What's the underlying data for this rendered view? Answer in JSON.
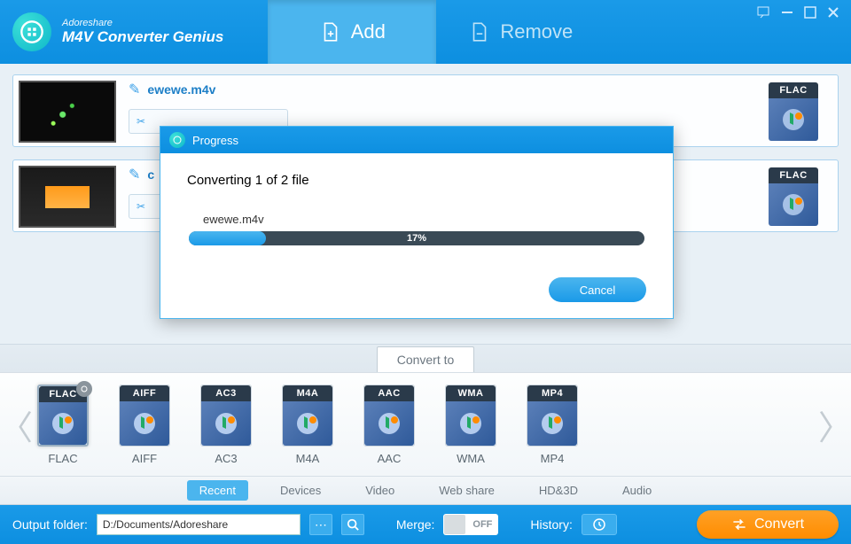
{
  "brand": {
    "company": "Adoreshare",
    "product": "M4V Converter Genius"
  },
  "header": {
    "add_label": "Add",
    "remove_label": "Remove"
  },
  "files": [
    {
      "name": "ewewe.m4v",
      "target_format": "FLAC"
    },
    {
      "name": "c",
      "target_format": "FLAC"
    }
  ],
  "convert_to_label": "Convert to",
  "formats": [
    {
      "label": "FLAC",
      "selected": true
    },
    {
      "label": "AIFF",
      "selected": false
    },
    {
      "label": "AC3",
      "selected": false
    },
    {
      "label": "M4A",
      "selected": false
    },
    {
      "label": "AAC",
      "selected": false
    },
    {
      "label": "WMA",
      "selected": false
    },
    {
      "label": "MP4",
      "selected": false
    }
  ],
  "categories": {
    "items": [
      "Recent",
      "Devices",
      "Video",
      "Web share",
      "HD&3D",
      "Audio"
    ],
    "active": "Recent"
  },
  "footer": {
    "output_label": "Output folder:",
    "output_path": "D:/Documents/Adoreshare",
    "merge_label": "Merge:",
    "merge_state": "OFF",
    "history_label": "History:",
    "convert_label": "Convert"
  },
  "dialog": {
    "title": "Progress",
    "status": "Converting 1 of 2 file",
    "current_file": "ewewe.m4v",
    "percent": 17,
    "percent_text": "17%",
    "cancel_label": "Cancel"
  }
}
